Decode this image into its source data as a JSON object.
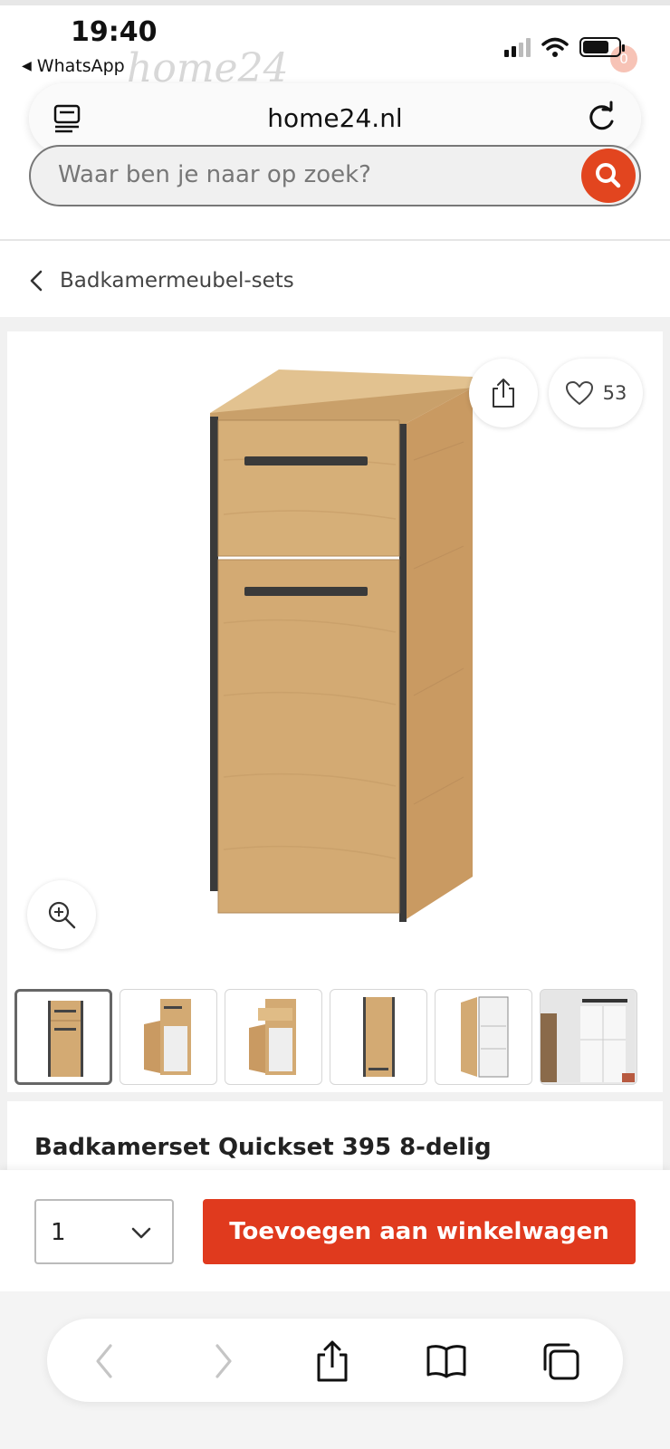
{
  "status_bar": {
    "time": "19:40",
    "back_app": "WhatsApp"
  },
  "site_header": {
    "logo": "home24",
    "cart_count": "0"
  },
  "url_bar": {
    "domain": "home24.nl"
  },
  "search": {
    "placeholder": "Waar ben je naar op zoek?"
  },
  "breadcrumb": {
    "label": "Badkamermeubel-sets"
  },
  "product": {
    "favorites_count": "53",
    "title": "Badkamerset Quickset 395 8-delig",
    "thumbnail_count": 6
  },
  "cart": {
    "quantity": "1",
    "add_label": "Toevoegen aan winkelwagen"
  },
  "colors": {
    "accent": "#e03a1e",
    "wood": "#d2ad7a",
    "frame": "#3a3a3a"
  }
}
